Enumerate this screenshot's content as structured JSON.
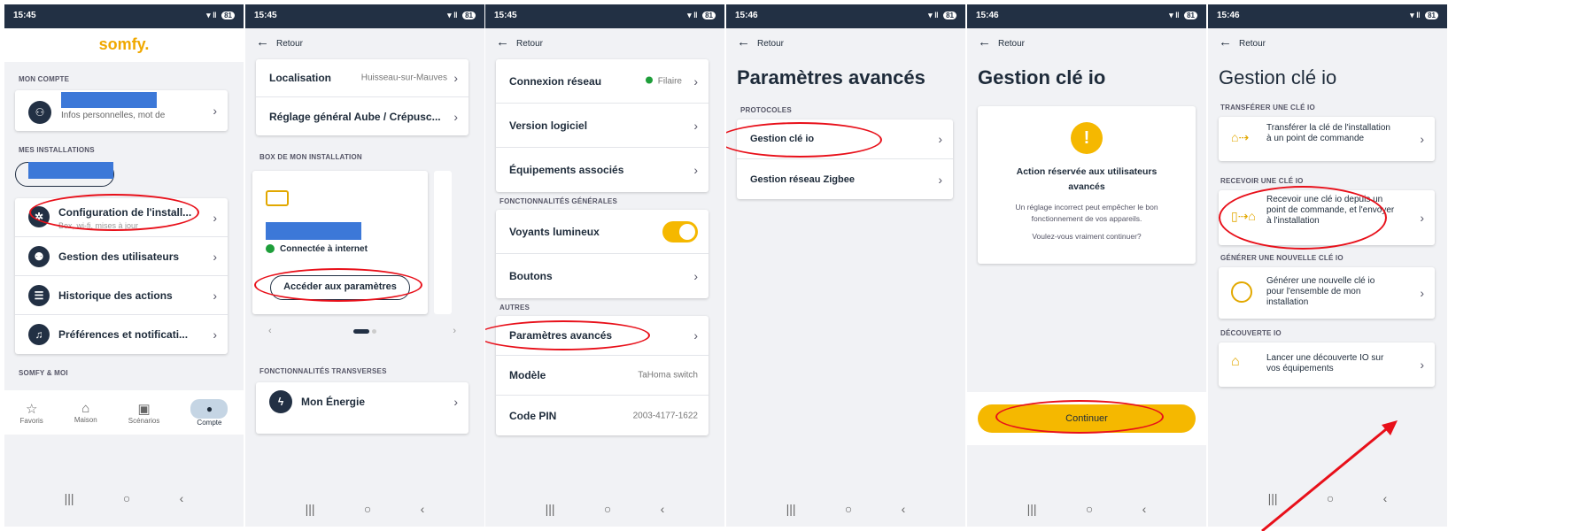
{
  "p1": {
    "time": "15:45",
    "battery": "81",
    "logo": "somfy.",
    "sec_account": "MON COMPTE",
    "account_sub": "Infos personnelles, mot de",
    "sec_install": "MES INSTALLATIONS",
    "config_label": "Configuration de l'install...",
    "config_sub": "Box, wi-fi, mises à jour",
    "users_label": "Gestion des utilisateurs",
    "history_label": "Historique des actions",
    "prefs_label": "Préférences et notificati...",
    "sec_somfy": "SOMFY & MOI",
    "nav": [
      "Favoris",
      "Maison",
      "Scénarios",
      "Compte"
    ]
  },
  "p2": {
    "time": "15:45",
    "battery": "81",
    "back": "Retour",
    "loc_label": "Localisation",
    "loc_val": "Huisseau-sur-Mauves",
    "reglage": "Réglage général Aube / Crépusc...",
    "sec_box": "BOX DE MON INSTALLATION",
    "connected": "Connectée à internet",
    "access": "Accéder aux paramètres",
    "sec_trans": "FONCTIONNALITÉS TRANSVERSES",
    "energy": "Mon Énergie"
  },
  "p3": {
    "time": "15:45",
    "battery": "81",
    "back": "Retour",
    "net_label": "Connexion réseau",
    "net_val": "Filaire",
    "version": "Version logiciel",
    "equip": "Équipements associés",
    "sec_gen": "FONCTIONNALITÉS GÉNÉRALES",
    "voyants": "Voyants lumineux",
    "boutons": "Boutons",
    "sec_autres": "AUTRES",
    "avances": "Paramètres avancés",
    "modele": "Modèle",
    "modele_val": "TaHoma switch",
    "pin": "Code PIN",
    "pin_val": "2003-4177-1622"
  },
  "p4": {
    "time": "15:46",
    "battery": "81",
    "back": "Retour",
    "title": "Paramètres avancés",
    "sec_proto": "PROTOCOLES",
    "io": "Gestion clé io",
    "zigbee": "Gestion réseau Zigbee"
  },
  "p5": {
    "time": "15:46",
    "battery": "81",
    "back": "Retour",
    "title": "Gestion clé io",
    "warn_title": "Action réservée aux utilisateurs avancés",
    "warn_body": "Un réglage incorrect peut empêcher le bon fonctionnement de vos appareils.",
    "warn_q": "Voulez-vous vraiment continuer?",
    "continue": "Continuer"
  },
  "p6": {
    "time": "15:46",
    "battery": "81",
    "back": "Retour",
    "title": "Gestion clé io",
    "sec_transfer": "TRANSFÉRER UNE CLÉ IO",
    "transfer": "Transférer la clé de l'installation à un point de commande",
    "sec_receive": "RECEVOIR UNE CLÉ IO",
    "receive": "Recevoir une clé io depuis un point de commande, et l'envoyer à l'installation",
    "sec_generate": "GÉNÉRER UNE NOUVELLE CLÉ IO",
    "generate": "Générer une nouvelle clé io pour l'ensemble de mon installation",
    "sec_disco": "DÉCOUVERTE IO",
    "disco": "Lancer une découverte IO sur vos équipements"
  },
  "colors": {
    "status_bar": "#223044",
    "toggle": "#f5b800",
    "annotation": "#e8101a",
    "brand": "#f0a800",
    "online": "#1e9e3a"
  }
}
